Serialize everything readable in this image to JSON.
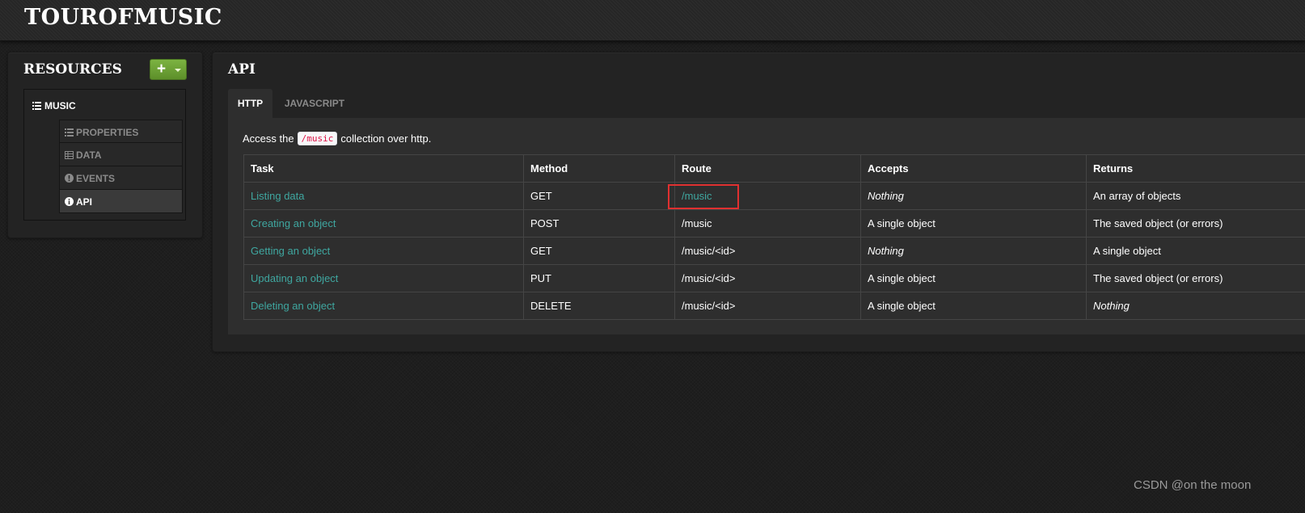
{
  "app": {
    "brand": "TOUROFMUSIC"
  },
  "sidebar": {
    "title": "RESOURCES",
    "add_label": "+",
    "resource": {
      "label": "MUSIC",
      "icon": "list-icon"
    },
    "items": [
      {
        "label": "PROPERTIES",
        "icon": "list-icon",
        "active": false
      },
      {
        "label": "DATA",
        "icon": "table-icon",
        "active": false
      },
      {
        "label": "EVENTS",
        "icon": "exclamation-circle-icon",
        "active": false
      },
      {
        "label": "API",
        "icon": "info-circle-icon",
        "active": true
      }
    ]
  },
  "main": {
    "title": "API",
    "tabs": [
      {
        "label": "HTTP",
        "active": true
      },
      {
        "label": "JAVASCRIPT",
        "active": false
      }
    ],
    "access": {
      "prefix": "Access the",
      "code": "/music",
      "suffix": "collection over http."
    },
    "table": {
      "headers": [
        "Task",
        "Method",
        "Route",
        "Accepts",
        "Returns"
      ],
      "rows": [
        [
          "Listing data",
          "GET",
          "/music",
          "Nothing",
          "An array of objects"
        ],
        [
          "Creating an object",
          "POST",
          "/music",
          "A single object",
          "The saved object (or errors)"
        ],
        [
          "Getting an object",
          "GET",
          "/music/<id>",
          "Nothing",
          "A single object"
        ],
        [
          "Updating an object",
          "PUT",
          "/music/<id>",
          "A single object",
          "The saved object (or errors)"
        ],
        [
          "Deleting an object",
          "DELETE",
          "/music/<id>",
          "A single object",
          "Nothing"
        ]
      ]
    }
  },
  "colors": {
    "accent_link": "#3fa7a0",
    "add_button": "#6fa336",
    "highlight": "#e03030"
  },
  "watermark": "CSDN @on the moon"
}
